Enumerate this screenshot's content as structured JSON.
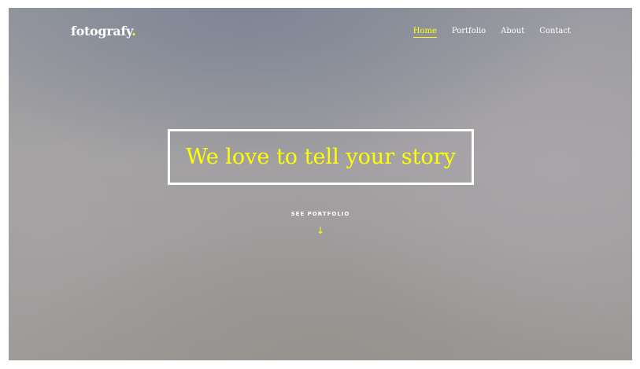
{
  "brand": {
    "name": "fotografy",
    "dot": ".",
    "accent_color": "#ffff00"
  },
  "nav": {
    "items": [
      {
        "label": "Home",
        "active": true
      },
      {
        "label": "Portfolio",
        "active": false
      },
      {
        "label": "About",
        "active": false
      },
      {
        "label": "Contact",
        "active": false
      }
    ]
  },
  "hero": {
    "title": "We love to tell your story",
    "cta_label": "SEE PORTFOLIO",
    "cta_icon": "arrow-down-icon",
    "cta_glyph": "↓"
  }
}
